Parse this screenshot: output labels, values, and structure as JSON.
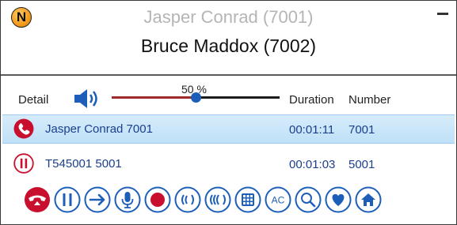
{
  "window": {
    "logo_letter": "N",
    "caller_title": "Jasper Conrad (7001)",
    "active_title": "Bruce Maddox (7002)"
  },
  "columns": {
    "detail": "Detail",
    "duration": "Duration",
    "number": "Number"
  },
  "volume": {
    "label": "50 %",
    "level_percent": 50
  },
  "calls": [
    {
      "name": "Jasper Conrad 7001",
      "duration": "00:01:11",
      "number": "7001",
      "state_icon": "phone-active-icon",
      "selected": true
    },
    {
      "name": "T545001 5001",
      "duration": "00:01:03",
      "number": "5001",
      "state_icon": "pause-icon",
      "selected": false
    }
  ],
  "toolbar": {
    "buttons": [
      "hangup-icon",
      "hold-icon",
      "transfer-icon",
      "mute-mic-icon",
      "record-icon",
      "conference-icon",
      "conference-all-icon",
      "dialpad-icon",
      "ac-icon",
      "search-icon",
      "favorite-icon",
      "home-icon"
    ],
    "ac_label": "AC"
  },
  "colors": {
    "accent_blue": "#1d5fb8",
    "alert_red": "#c8102e",
    "selection_bg": "#cfe7fa"
  }
}
